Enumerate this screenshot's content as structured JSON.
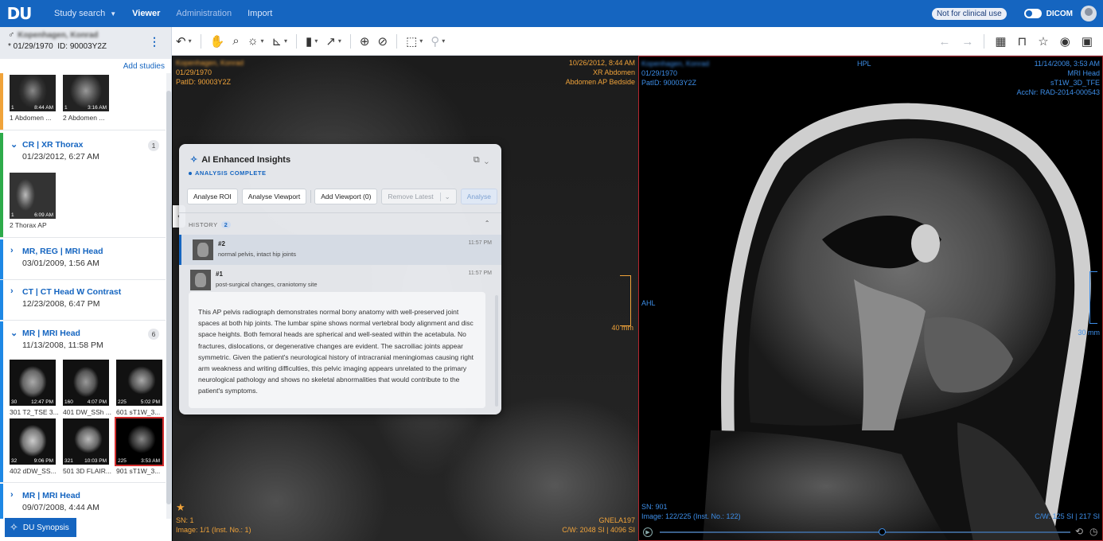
{
  "app": {
    "logo": "DU"
  },
  "nav": [
    {
      "label": "Study search",
      "caret": "▼"
    },
    {
      "label": "Viewer"
    },
    {
      "label": "Administration"
    },
    {
      "label": "Import"
    }
  ],
  "header_right": {
    "badge": "Not for clinical use",
    "dicom_label": "DICOM"
  },
  "patient": {
    "gender_symbol": "♂",
    "name": "Kopenhagen, Konrad",
    "dob": "* 01/29/1970",
    "id": "ID: 90003Y2Z"
  },
  "sidebar": {
    "add_studies": "Add studies",
    "top_thumbs": [
      {
        "count": "1",
        "time": "8:44 AM",
        "label": "1 Abdomen ..."
      },
      {
        "count": "1",
        "time": "3:16 AM",
        "label": "2 Abdomen ..."
      }
    ],
    "studies": [
      {
        "title": "CR | XR Thorax",
        "date": "01/23/2012, 6:27 AM",
        "count": "1",
        "color": "#2eab4a",
        "expanded": true,
        "thumbs": [
          {
            "count": "1",
            "time": "6:09 AM",
            "label": "2 Thorax AP"
          }
        ]
      },
      {
        "title": "MR, REG | MRI Head",
        "date": "03/01/2009, 1:56 AM",
        "color": "#1e88e5"
      },
      {
        "title": "CT | CT Head W Contrast",
        "date": "12/23/2008, 6:47 PM",
        "color": "#1e88e5"
      },
      {
        "title": "MR | MRI Head",
        "date": "11/13/2008, 11:58 PM",
        "count": "6",
        "color": "#1e88e5",
        "expanded": true,
        "thumbs": [
          {
            "count": "30",
            "time": "12:47 PM",
            "label": "301 T2_TSE 3..."
          },
          {
            "count": "160",
            "time": "4:07 PM",
            "label": "401 DW_SSh ..."
          },
          {
            "count": "225",
            "time": "5:02 PM",
            "label": "601 sT1W_3..."
          },
          {
            "count": "32",
            "time": "9:06 PM",
            "label": "402 dDW_SS..."
          },
          {
            "count": "321",
            "time": "10:03 PM",
            "label": "501 3D FLAIR..."
          },
          {
            "count": "225",
            "time": "3:53 AM",
            "label": "901 sT1W_3..."
          }
        ]
      },
      {
        "title": "MR | MRI Head",
        "date": "09/07/2008, 4:44 AM",
        "color": "#1e88e5"
      }
    ],
    "synopsis_label": "DU Synopsis"
  },
  "toolbar_icons": [
    "undo-icon",
    "pan-icon",
    "zoom-icon",
    "brightness-icon",
    "measure-icon",
    "layout-icon",
    "arrow-icon",
    "crosshair-icon",
    "link-icon",
    "cube-icon",
    "dropper-icon"
  ],
  "toolbar_right_icons": [
    "back-icon",
    "forward-icon",
    "grid-icon",
    "presentation-icon",
    "star-icon",
    "eye-icon",
    "save-icon"
  ],
  "viewport1": {
    "tl": [
      "Kopenhagen, Konrad",
      "01/29/1970",
      "PatID: 90003Y2Z"
    ],
    "tr": [
      "10/26/2012, 8:44 AM",
      "XR Abdomen",
      "Abdomen AP Bedside"
    ],
    "bl": [
      "SN: 1",
      "Image: 1/1 (Inst. No.: 1)"
    ],
    "br": [
      "GNELA197",
      "C/W: 2048 SI | 4096 SI"
    ],
    "scale": "40 mm",
    "orientation": "AHL"
  },
  "viewport2": {
    "tl": [
      "Kopenhagen, Konrad",
      "01/29/1970",
      "PatID: 90003Y2Z"
    ],
    "tc": "HPL",
    "tr": [
      "11/14/2008, 3:53 AM",
      "MRI Head",
      "sT1W_3D_TFE",
      "AccNr: RAD-2014-000543"
    ],
    "bl": [
      "SN: 901",
      "Image: 122/225 (Inst. No.: 122)"
    ],
    "br": [
      "C/W: 125 SI | 217 SI"
    ],
    "scale": "30 mm",
    "slice_progress": 0.54
  },
  "ai_panel": {
    "title": "AI Enhanced Insights",
    "status": "ANALYSIS COMPLETE",
    "buttons": [
      "Analyse ROI",
      "Analyse Viewport",
      "Add Viewport (0)",
      "Remove Latest",
      "Analyse"
    ],
    "history_label": "HISTORY",
    "history_count": "2",
    "history": [
      {
        "id": "#2",
        "desc": "normal pelvis, intact hip joints",
        "time": "11:57 PM"
      },
      {
        "id": "#1",
        "desc": "post-surgical changes, craniotomy site",
        "time": "11:57 PM"
      }
    ],
    "synthesis": "This AP pelvis radiograph demonstrates normal bony anatomy with well-preserved joint spaces at both hip joints. The lumbar spine shows normal vertebral body alignment and disc space heights. Both femoral heads are spherical and well-seated within the acetabula. No fractures, dislocations, or degenerative changes are evident. The sacroiliac joints appear symmetric. Given the patient's neurological history of intracranial meningiomas causing right arm weakness and writing difficulties, this pelvic imaging appears unrelated to the primary neurological pathology and shows no skeletal abnormalities that would contribute to the patient's symptoms."
  }
}
